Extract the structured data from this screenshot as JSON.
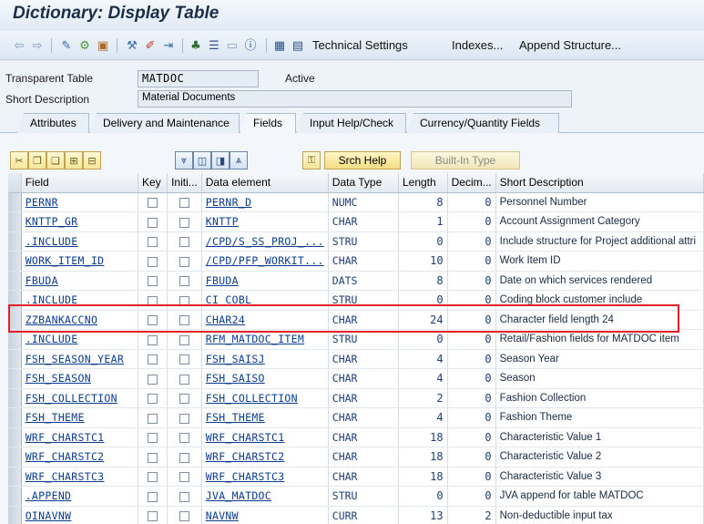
{
  "window": {
    "title": "Dictionary: Display Table"
  },
  "toolbar": {
    "technical_settings": "Technical Settings",
    "indexes": "Indexes...",
    "append_structure": "Append Structure..."
  },
  "header": {
    "table_label": "Transparent Table",
    "table_value": "MATDOC",
    "status": "Active",
    "short_desc_label": "Short Description",
    "short_desc_value": "Material Documents"
  },
  "tabs": [
    {
      "label": "Attributes"
    },
    {
      "label": "Delivery and Maintenance"
    },
    {
      "label": "Fields"
    },
    {
      "label": "Input Help/Check"
    },
    {
      "label": "Currency/Quantity Fields"
    }
  ],
  "table_toolbar": {
    "search_help": "Srch Help",
    "builtin_type": "Built-In Type"
  },
  "columns": [
    "Field",
    "Key",
    "Initi...",
    "Data element",
    "Data Type",
    "Length",
    "Decim...",
    "Short Description"
  ],
  "rows": [
    {
      "field": "PERNR",
      "element": "PERNR_D",
      "type": "NUMC",
      "length": "8",
      "decimals": "0",
      "desc": "Personnel Number"
    },
    {
      "field": "KNTTP_GR",
      "element": "KNTTP",
      "type": "CHAR",
      "length": "1",
      "decimals": "0",
      "desc": "Account Assignment Category"
    },
    {
      "field": ".INCLUDE",
      "element": "/CPD/S_SS_PROJ_...",
      "type": "STRU",
      "length": "0",
      "decimals": "0",
      "desc": "Include structure for Project additional attri"
    },
    {
      "field": "WORK_ITEM_ID",
      "element": "/CPD/PFP_WORKIT...",
      "type": "CHAR",
      "length": "10",
      "decimals": "0",
      "desc": "Work Item ID"
    },
    {
      "field": "FBUDA",
      "element": "FBUDA",
      "type": "DATS",
      "length": "8",
      "decimals": "0",
      "desc": "Date on which services rendered"
    },
    {
      "field": ".INCLUDE",
      "element": "CI_COBL",
      "type": "STRU",
      "length": "0",
      "decimals": "0",
      "desc": "Coding block customer include"
    },
    {
      "field": "ZZBANKACCNO",
      "element": "CHAR24",
      "type": "CHAR",
      "length": "24",
      "decimals": "0",
      "desc": "Character field length 24"
    },
    {
      "field": ".INCLUDE",
      "element": "RFM_MATDOC_ITEM",
      "type": "STRU",
      "length": "0",
      "decimals": "0",
      "desc": "Retail/Fashion fields for MATDOC item"
    },
    {
      "field": "FSH_SEASON_YEAR",
      "element": "FSH_SAISJ",
      "type": "CHAR",
      "length": "4",
      "decimals": "0",
      "desc": "Season Year"
    },
    {
      "field": "FSH_SEASON",
      "element": "FSH_SAISO",
      "type": "CHAR",
      "length": "4",
      "decimals": "0",
      "desc": "Season"
    },
    {
      "field": "FSH_COLLECTION",
      "element": "FSH_COLLECTION",
      "type": "CHAR",
      "length": "2",
      "decimals": "0",
      "desc": "Fashion Collection"
    },
    {
      "field": "FSH_THEME",
      "element": "FSH_THEME",
      "type": "CHAR",
      "length": "4",
      "decimals": "0",
      "desc": "Fashion Theme"
    },
    {
      "field": "WRF_CHARSTC1",
      "element": "WRF_CHARSTC1",
      "type": "CHAR",
      "length": "18",
      "decimals": "0",
      "desc": "Characteristic Value 1"
    },
    {
      "field": "WRF_CHARSTC2",
      "element": "WRF_CHARSTC2",
      "type": "CHAR",
      "length": "18",
      "decimals": "0",
      "desc": "Characteristic Value 2"
    },
    {
      "field": "WRF_CHARSTC3",
      "element": "WRF_CHARSTC3",
      "type": "CHAR",
      "length": "18",
      "decimals": "0",
      "desc": "Characteristic Value 3"
    },
    {
      "field": ".APPEND",
      "element": "JVA_MATDOC",
      "type": "STRU",
      "length": "0",
      "decimals": "0",
      "desc": "JVA append for table MATDOC"
    },
    {
      "field": "OINAVNW",
      "element": "NAVNW",
      "type": "CURR",
      "length": "13",
      "decimals": "2",
      "desc": "Non-deductible input tax"
    }
  ]
}
